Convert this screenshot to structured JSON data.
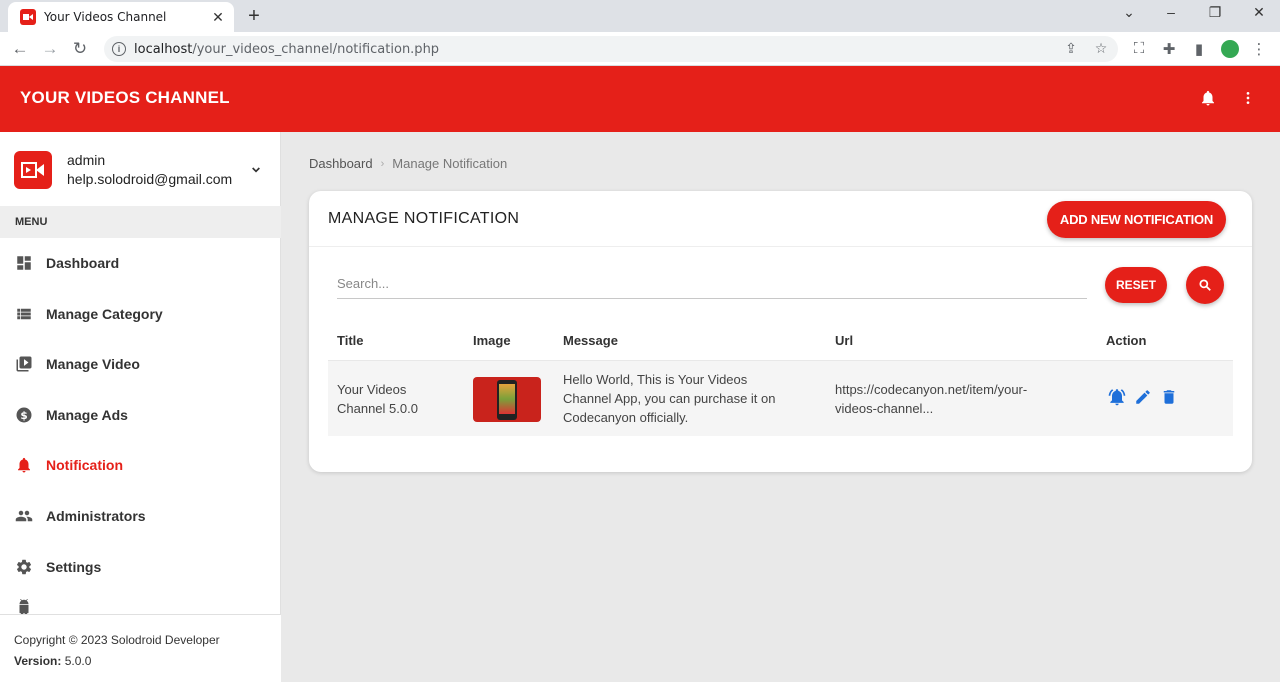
{
  "browser": {
    "tab_title": "Your Videos Channel",
    "url_host": "localhost",
    "url_path": "/your_videos_channel/notification.php"
  },
  "app": {
    "brand": "YOUR VIDEOS CHANNEL",
    "accent_color": "#e52019",
    "action_icon_color": "#1e6fd9"
  },
  "user": {
    "name": "admin",
    "email": "help.solodroid@gmail.com"
  },
  "sidebar": {
    "menu_header": "MENU",
    "items": [
      {
        "label": "Dashboard",
        "icon": "dashboard-icon"
      },
      {
        "label": "Manage Category",
        "icon": "list-icon"
      },
      {
        "label": "Manage Video",
        "icon": "video-library-icon"
      },
      {
        "label": "Manage Ads",
        "icon": "dollar-icon"
      },
      {
        "label": "Notification",
        "icon": "bell-icon",
        "active": true
      },
      {
        "label": "Administrators",
        "icon": "people-icon"
      },
      {
        "label": "Settings",
        "icon": "gear-icon"
      }
    ]
  },
  "footer": {
    "copyright": "Copyright © 2023 Solodroid Developer",
    "version_label": "Version:",
    "version_value": "5.0.0"
  },
  "breadcrumb": {
    "home": "Dashboard",
    "current": "Manage Notification"
  },
  "card": {
    "title": "MANAGE NOTIFICATION",
    "add_button": "ADD NEW NOTIFICATION",
    "search_placeholder": "Search...",
    "reset_button": "RESET"
  },
  "table": {
    "headers": [
      "Title",
      "Image",
      "Message",
      "Url",
      "Action"
    ],
    "rows": [
      {
        "title_line1": "Your Videos",
        "title_line2": "Channel 5.0.0",
        "message_line1": "Hello World, This is Your Videos",
        "message_line2": "Channel App, you can purchase it on",
        "message_line3": "Codecanyon officially.",
        "url_line1": "https://codecanyon.net/item/your-",
        "url_line2": "videos-channel..."
      }
    ]
  }
}
